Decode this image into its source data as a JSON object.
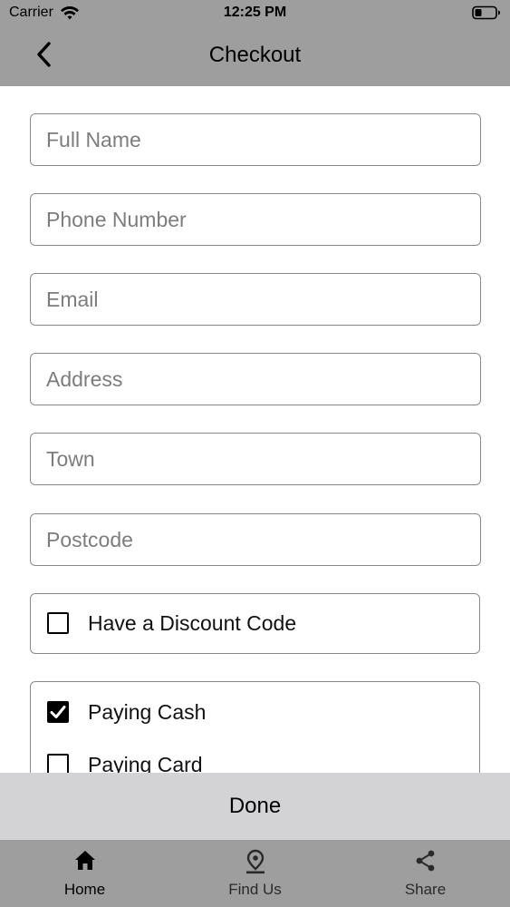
{
  "status_bar": {
    "carrier": "Carrier",
    "time": "12:25 PM"
  },
  "nav": {
    "title": "Checkout",
    "back_icon": "chevron-left-icon"
  },
  "form": {
    "fields": [
      {
        "placeholder": "Full Name",
        "value": ""
      },
      {
        "placeholder": "Phone Number",
        "value": ""
      },
      {
        "placeholder": "Email",
        "value": ""
      },
      {
        "placeholder": "Address",
        "value": ""
      },
      {
        "placeholder": "Town",
        "value": ""
      },
      {
        "placeholder": "Postcode",
        "value": ""
      }
    ],
    "discount": {
      "label": "Have a Discount Code",
      "checked": false
    },
    "payment": [
      {
        "label": "Paying Cash",
        "checked": true
      },
      {
        "label": "Paying Card",
        "checked": false
      }
    ]
  },
  "done_label": "Done",
  "tabs": [
    {
      "label": "Home",
      "icon": "home-icon",
      "active": true
    },
    {
      "label": "Find Us",
      "icon": "map-pin-icon",
      "active": false
    },
    {
      "label": "Share",
      "icon": "share-icon",
      "active": false
    }
  ],
  "colors": {
    "bar_gray": "#9e9e9f",
    "done_bar": "#d3d3d6",
    "active_tab": "#000000",
    "inactive_tab": "#2a2a2a"
  }
}
